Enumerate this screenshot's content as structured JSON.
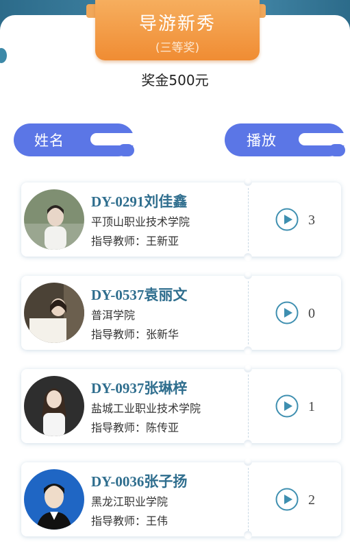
{
  "banner": {
    "title": "导游新秀",
    "subtitle": "(三等奖)"
  },
  "prize": "奖金500元",
  "headers": {
    "name": "姓名",
    "play": "播放"
  },
  "colors": {
    "accent_blue": "#5b76e6",
    "banner_orange": "#f08c33",
    "teal_text": "#2f6e8e"
  },
  "entries": [
    {
      "name": "DY-0291刘佳鑫",
      "school": "平顶山职业技术学院",
      "teacher": "指导教师：王新亚",
      "plays": "3",
      "play_icon": "play-circle-icon"
    },
    {
      "name": "DY-0537袁丽文",
      "school": "普洱学院",
      "teacher": "指导教师：张新华",
      "plays": "0",
      "play_icon": "play-circle-icon"
    },
    {
      "name": "DY-0937张琳梓",
      "school": "盐城工业职业技术学院",
      "teacher": "指导教师：陈传亚",
      "plays": "1",
      "play_icon": "play-circle-icon"
    },
    {
      "name": "DY-0036张子扬",
      "school": "黑龙江职业学院",
      "teacher": "指导教师：王伟",
      "plays": "2",
      "play_icon": "play-circle-icon"
    }
  ]
}
